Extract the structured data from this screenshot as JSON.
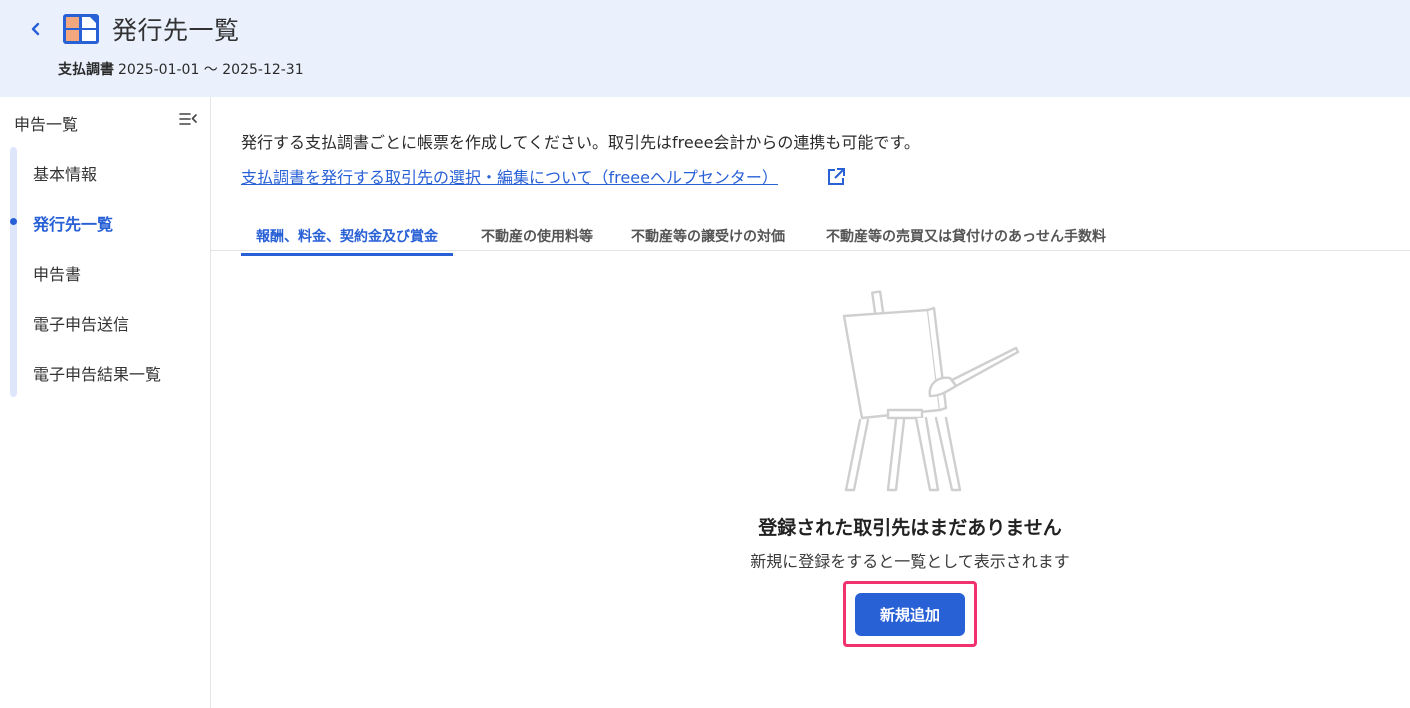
{
  "header": {
    "title": "発行先一覧",
    "doc_type": "支払調書",
    "period": "2025-01-01 〜 2025-12-31"
  },
  "sidebar": {
    "heading": "申告一覧",
    "items": [
      {
        "label": "基本情報",
        "active": false
      },
      {
        "label": "発行先一覧",
        "active": true
      },
      {
        "label": "申告書",
        "active": false
      },
      {
        "label": "電子申告送信",
        "active": false
      },
      {
        "label": "電子申告結果一覧",
        "active": false
      }
    ]
  },
  "main": {
    "intro": "発行する支払調書ごとに帳票を作成してください。取引先はfreee会計からの連携も可能です。",
    "help_link": "支払調書を発行する取引先の選択・編集について（freeeヘルプセンター）",
    "tabs": [
      {
        "label": "報酬、料金、契約金及び賞金",
        "active": true
      },
      {
        "label": "不動産の使用料等",
        "active": false
      },
      {
        "label": "不動産等の譲受けの対価",
        "active": false
      },
      {
        "label": "不動産等の売買又は貸付けのあっせん手数料",
        "active": false
      }
    ],
    "empty_title": "登録された取引先はまだありません",
    "empty_desc": "新規に登録をすると一覧として表示されます",
    "add_button": "新規追加"
  },
  "colors": {
    "accent": "#2860d6",
    "header_bg": "#eaf1fd",
    "highlight": "#f0336e",
    "icon_orange": "#f2a77e"
  },
  "icons": {
    "back": "chevron-left-icon",
    "app": "document-layout-icon",
    "collapse": "collapse-menu-icon",
    "external": "external-link-icon",
    "empty": "easel-paintbrush-illustration"
  }
}
